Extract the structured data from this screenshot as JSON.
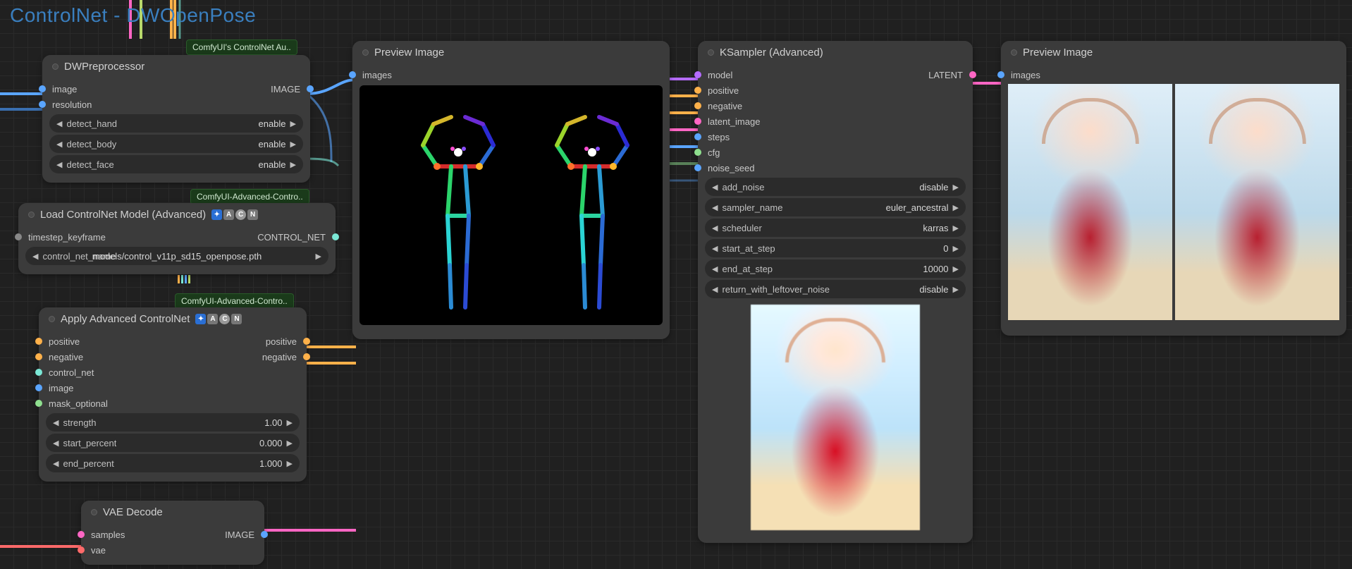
{
  "group_title": "ControlNet - DWOpenPose",
  "tooltips": {
    "controlnet_aux": "ComfyUI's ControlNet Au..",
    "adv_controlnet_1": "ComfyUI-Advanced-Contro..",
    "adv_controlnet_2": "ComfyUI-Advanced-Contro.."
  },
  "nodes": {
    "dw": {
      "title": "DWPreprocessor",
      "inputs": {
        "image": "image",
        "resolution": "resolution"
      },
      "outputs": {
        "IMAGE": "IMAGE"
      },
      "widgets": [
        {
          "name": "detect_hand",
          "value": "enable"
        },
        {
          "name": "detect_body",
          "value": "enable"
        },
        {
          "name": "detect_face",
          "value": "enable"
        }
      ]
    },
    "loadcn": {
      "title": "Load ControlNet Model (Advanced)",
      "inputs": {
        "timestep_keyframe": "timestep_keyframe"
      },
      "outputs": {
        "CONTROL_NET": "CONTROL_NET"
      },
      "widgets": [
        {
          "name": "control_net_name",
          "value": "models/control_v11p_sd15_openpose.pth"
        }
      ]
    },
    "apply": {
      "title": "Apply Advanced ControlNet",
      "inputs": {
        "positive": "positive",
        "negative": "negative",
        "control_net": "control_net",
        "image": "image",
        "mask_optional": "mask_optional"
      },
      "outputs": {
        "positive": "positive",
        "negative": "negative"
      },
      "widgets": [
        {
          "name": "strength",
          "value": "1.00"
        },
        {
          "name": "start_percent",
          "value": "0.000"
        },
        {
          "name": "end_percent",
          "value": "1.000"
        }
      ]
    },
    "vaedec": {
      "title": "VAE Decode",
      "inputs": {
        "samples": "samples",
        "vae": "vae"
      },
      "outputs": {
        "IMAGE": "IMAGE"
      }
    },
    "preview1": {
      "title": "Preview Image",
      "inputs": {
        "images": "images"
      }
    },
    "ksampler": {
      "title": "KSampler (Advanced)",
      "inputs": {
        "model": "model",
        "positive": "positive",
        "negative": "negative",
        "latent_image": "latent_image",
        "steps": "steps",
        "cfg": "cfg",
        "noise_seed": "noise_seed"
      },
      "outputs": {
        "LATENT": "LATENT"
      },
      "widgets": [
        {
          "name": "add_noise",
          "value": "disable"
        },
        {
          "name": "sampler_name",
          "value": "euler_ancestral"
        },
        {
          "name": "scheduler",
          "value": "karras"
        },
        {
          "name": "start_at_step",
          "value": "0"
        },
        {
          "name": "end_at_step",
          "value": "10000"
        },
        {
          "name": "return_with_leftover_noise",
          "value": "disable"
        }
      ]
    },
    "preview2": {
      "title": "Preview Image",
      "inputs": {
        "images": "images"
      }
    }
  },
  "colors": {
    "image": "#5aa5ff",
    "latent": "#ff66c4",
    "model": "#b56bff",
    "cond_pos": "#ffb14a",
    "cond_neg": "#ffb14a",
    "control_net": "#7be8d6",
    "int": "#6aa564",
    "float": "#b7d86b",
    "vae": "#ff6a6a",
    "steps": "#5aa5ff",
    "cfg": "#8fe08f",
    "seed": "#5aa5ff"
  }
}
